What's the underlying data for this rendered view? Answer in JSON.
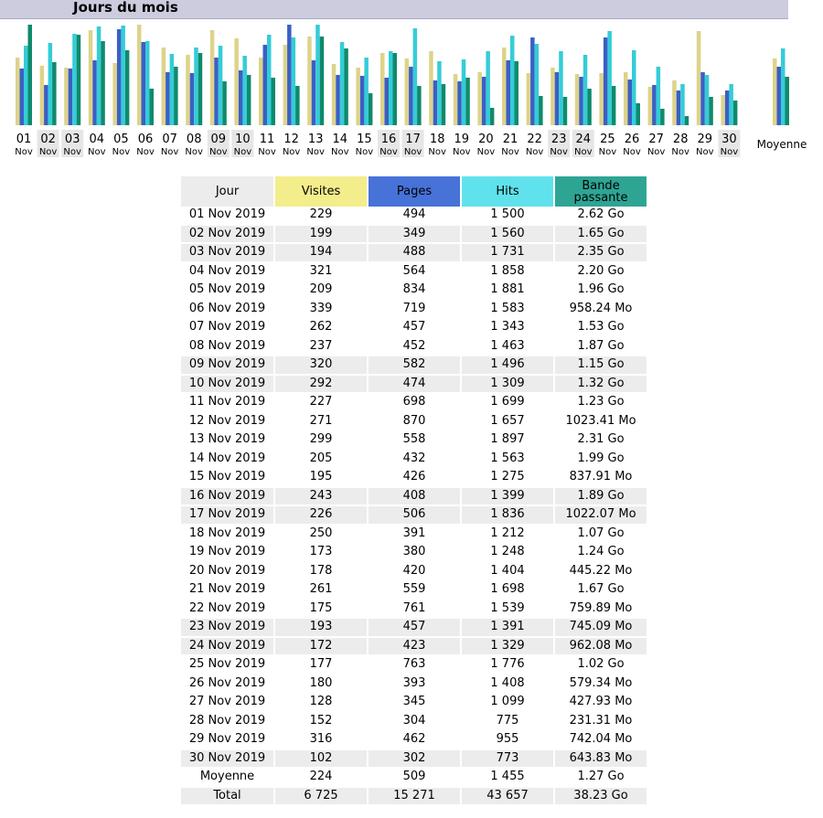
{
  "header": {
    "title": "Jours du mois"
  },
  "colors": {
    "visits": "#ddd38a",
    "pages": "#3c5fc4",
    "hits": "#35ccd8",
    "bandwidth": "#0f8a6c",
    "header_visits": "#f3ed8b",
    "header_pages": "#4772d8",
    "header_hits": "#5fe2ec",
    "header_bandwidth": "#2ea594"
  },
  "chart_data": {
    "type": "bar",
    "categories": [
      "01",
      "02",
      "03",
      "04",
      "05",
      "06",
      "07",
      "08",
      "09",
      "10",
      "11",
      "12",
      "13",
      "14",
      "15",
      "16",
      "17",
      "18",
      "19",
      "20",
      "21",
      "22",
      "23",
      "24",
      "25",
      "26",
      "27",
      "28",
      "29",
      "30"
    ],
    "category_sub": "Nov",
    "weekend_days": [
      "02",
      "03",
      "09",
      "10",
      "16",
      "17",
      "23",
      "24",
      "30"
    ],
    "average_label": "Moyenne",
    "series": [
      {
        "key": "visits",
        "values": [
          229,
          199,
          194,
          321,
          209,
          339,
          262,
          237,
          320,
          292,
          227,
          271,
          299,
          205,
          195,
          243,
          226,
          250,
          173,
          178,
          261,
          175,
          193,
          172,
          177,
          180,
          128,
          152,
          316,
          102
        ],
        "average": 224
      },
      {
        "key": "pages",
        "values": [
          494,
          349,
          488,
          564,
          834,
          719,
          457,
          452,
          582,
          474,
          698,
          870,
          558,
          432,
          426,
          408,
          506,
          391,
          380,
          420,
          559,
          761,
          457,
          423,
          763,
          393,
          345,
          304,
          462,
          302
        ],
        "average": 509
      },
      {
        "key": "hits",
        "values": [
          1500,
          1560,
          1731,
          1858,
          1881,
          1583,
          1343,
          1463,
          1496,
          1309,
          1699,
          1657,
          1897,
          1563,
          1275,
          1399,
          1836,
          1212,
          1248,
          1404,
          1698,
          1539,
          1391,
          1329,
          1776,
          1408,
          1099,
          775,
          955,
          773
        ],
        "average": 1455
      },
      {
        "key": "bandwidth_go",
        "values": [
          2.62,
          1.65,
          2.35,
          2.2,
          1.96,
          0.958,
          1.53,
          1.87,
          1.15,
          1.32,
          1.23,
          1.023,
          2.31,
          1.99,
          0.838,
          1.89,
          1.022,
          1.07,
          1.24,
          0.445,
          1.67,
          0.76,
          0.745,
          0.962,
          1.02,
          0.579,
          0.428,
          0.231,
          0.742,
          0.644
        ],
        "average": 1.27
      }
    ]
  },
  "table": {
    "headers": [
      "Jour",
      "Visites",
      "Pages",
      "Hits",
      "Bande passante"
    ],
    "rows": [
      [
        "01 Nov 2019",
        "229",
        "494",
        "1 500",
        "2.62 Go"
      ],
      [
        "02 Nov 2019",
        "199",
        "349",
        "1 560",
        "1.65 Go"
      ],
      [
        "03 Nov 2019",
        "194",
        "488",
        "1 731",
        "2.35 Go"
      ],
      [
        "04 Nov 2019",
        "321",
        "564",
        "1 858",
        "2.20 Go"
      ],
      [
        "05 Nov 2019",
        "209",
        "834",
        "1 881",
        "1.96 Go"
      ],
      [
        "06 Nov 2019",
        "339",
        "719",
        "1 583",
        "958.24 Mo"
      ],
      [
        "07 Nov 2019",
        "262",
        "457",
        "1 343",
        "1.53 Go"
      ],
      [
        "08 Nov 2019",
        "237",
        "452",
        "1 463",
        "1.87 Go"
      ],
      [
        "09 Nov 2019",
        "320",
        "582",
        "1 496",
        "1.15 Go"
      ],
      [
        "10 Nov 2019",
        "292",
        "474",
        "1 309",
        "1.32 Go"
      ],
      [
        "11 Nov 2019",
        "227",
        "698",
        "1 699",
        "1.23 Go"
      ],
      [
        "12 Nov 2019",
        "271",
        "870",
        "1 657",
        "1023.41 Mo"
      ],
      [
        "13 Nov 2019",
        "299",
        "558",
        "1 897",
        "2.31 Go"
      ],
      [
        "14 Nov 2019",
        "205",
        "432",
        "1 563",
        "1.99 Go"
      ],
      [
        "15 Nov 2019",
        "195",
        "426",
        "1 275",
        "837.91 Mo"
      ],
      [
        "16 Nov 2019",
        "243",
        "408",
        "1 399",
        "1.89 Go"
      ],
      [
        "17 Nov 2019",
        "226",
        "506",
        "1 836",
        "1022.07 Mo"
      ],
      [
        "18 Nov 2019",
        "250",
        "391",
        "1 212",
        "1.07 Go"
      ],
      [
        "19 Nov 2019",
        "173",
        "380",
        "1 248",
        "1.24 Go"
      ],
      [
        "20 Nov 2019",
        "178",
        "420",
        "1 404",
        "445.22 Mo"
      ],
      [
        "21 Nov 2019",
        "261",
        "559",
        "1 698",
        "1.67 Go"
      ],
      [
        "22 Nov 2019",
        "175",
        "761",
        "1 539",
        "759.89 Mo"
      ],
      [
        "23 Nov 2019",
        "193",
        "457",
        "1 391",
        "745.09 Mo"
      ],
      [
        "24 Nov 2019",
        "172",
        "423",
        "1 329",
        "962.08 Mo"
      ],
      [
        "25 Nov 2019",
        "177",
        "763",
        "1 776",
        "1.02 Go"
      ],
      [
        "26 Nov 2019",
        "180",
        "393",
        "1 408",
        "579.34 Mo"
      ],
      [
        "27 Nov 2019",
        "128",
        "345",
        "1 099",
        "427.93 Mo"
      ],
      [
        "28 Nov 2019",
        "152",
        "304",
        "775",
        "231.31 Mo"
      ],
      [
        "29 Nov 2019",
        "316",
        "462",
        "955",
        "742.04 Mo"
      ],
      [
        "30 Nov 2019",
        "102",
        "302",
        "773",
        "643.83 Mo"
      ]
    ],
    "average_row": [
      "Moyenne",
      "224",
      "509",
      "1 455",
      "1.27 Go"
    ],
    "total_row": [
      "Total",
      "6 725",
      "15 271",
      "43 657",
      "38.23 Go"
    ]
  }
}
